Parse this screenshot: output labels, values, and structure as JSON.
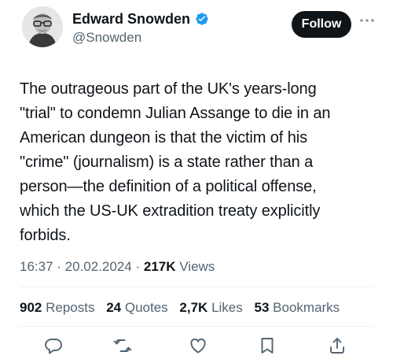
{
  "author": {
    "name": "Edward Snowden",
    "handle": "@Snowden",
    "verified": true,
    "follow_label": "Follow"
  },
  "tweet": {
    "text": "The outrageous part of the UK's years-long\n\"trial\" to condemn Julian Assange to die in an\nAmerican dungeon is that the victim of his\n\"crime\" (journalism) is a state rather than a\nperson—the definition of a political offense,\nwhich the US-UK extradition treaty explicitly\nforbids.",
    "time": "16:37",
    "date": "20.02.2024",
    "views_count": "217K",
    "views_label": "Views"
  },
  "stats": [
    {
      "count": "902",
      "label": "Reposts"
    },
    {
      "count": "24",
      "label": "Quotes"
    },
    {
      "count": "2,7K",
      "label": "Likes"
    },
    {
      "count": "53",
      "label": "Bookmarks"
    }
  ],
  "actions": [
    "reply-icon",
    "repost-icon",
    "like-icon",
    "bookmark-icon",
    "share-icon"
  ],
  "colors": {
    "text": "#0f1419",
    "secondary": "#536471",
    "verified": "#1d9bf0",
    "follow_bg": "#0f1419",
    "divider": "#eff3f4"
  }
}
